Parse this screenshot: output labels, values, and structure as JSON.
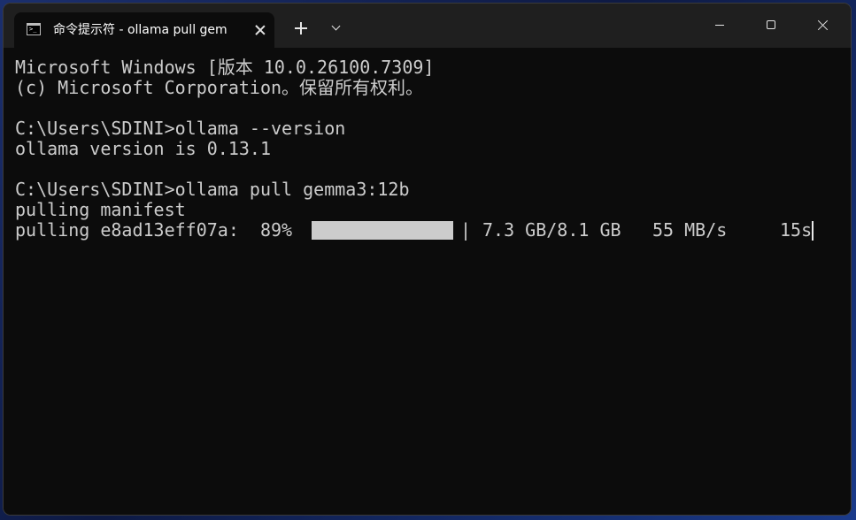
{
  "window": {
    "tab_title": "命令提示符 - ollama  pull gem",
    "icons": {
      "tab": "terminal-icon",
      "close_tab": "close-icon",
      "new_tab": "plus-icon",
      "dropdown": "chevron-down-icon",
      "minimize": "minimize-icon",
      "maximize": "maximize-icon",
      "close_window": "close-icon"
    }
  },
  "terminal": {
    "lines": [
      "Microsoft Windows [版本 10.0.26100.7309]",
      "(c) Microsoft Corporation。保留所有权利。",
      "C:\\Users\\SDINI>ollama --version",
      "ollama version is 0.13.1",
      "C:\\Users\\SDINI>ollama pull gemma3:12b",
      "pulling manifest"
    ],
    "progress": {
      "prefix": "pulling e8ad13eff07a:  89%",
      "fraction": 0.89,
      "separator": "|",
      "size": "7.3 GB/8.1 GB",
      "speed": "55 MB/s",
      "eta": "15s"
    }
  },
  "colors": {
    "background": "#0c0c0c",
    "titlebar": "#1f1f1f",
    "text": "#cccccc",
    "progress_fill": "#cccccc"
  }
}
